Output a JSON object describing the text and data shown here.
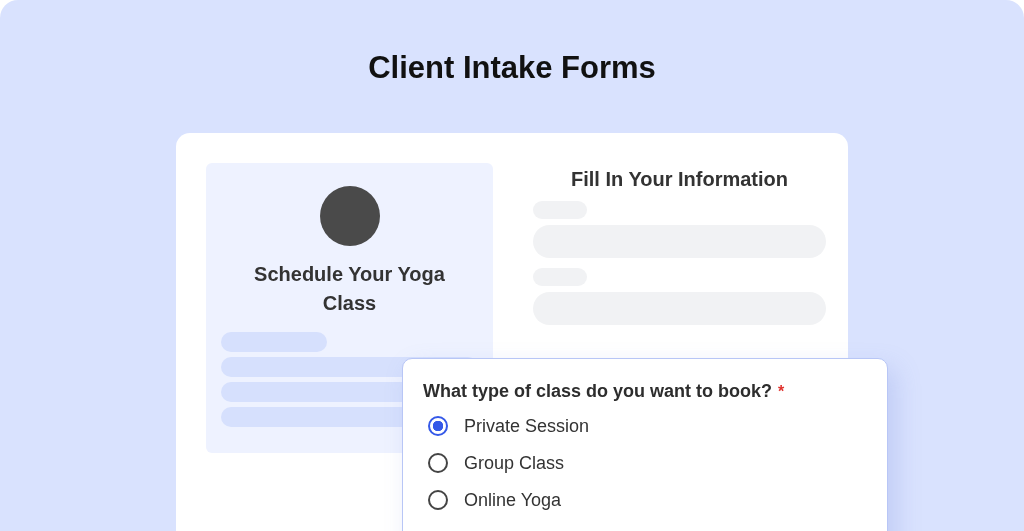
{
  "page_title": "Client Intake Forms",
  "booking_card": {
    "heading": "Schedule Your Yoga Class"
  },
  "form": {
    "title": "Fill In Your Information"
  },
  "question": {
    "label": "What type of class do you want to book?",
    "required_mark": "*",
    "options": [
      {
        "label": "Private Session",
        "selected": true
      },
      {
        "label": "Group Class",
        "selected": false
      },
      {
        "label": "Online Yoga",
        "selected": false
      }
    ]
  }
}
